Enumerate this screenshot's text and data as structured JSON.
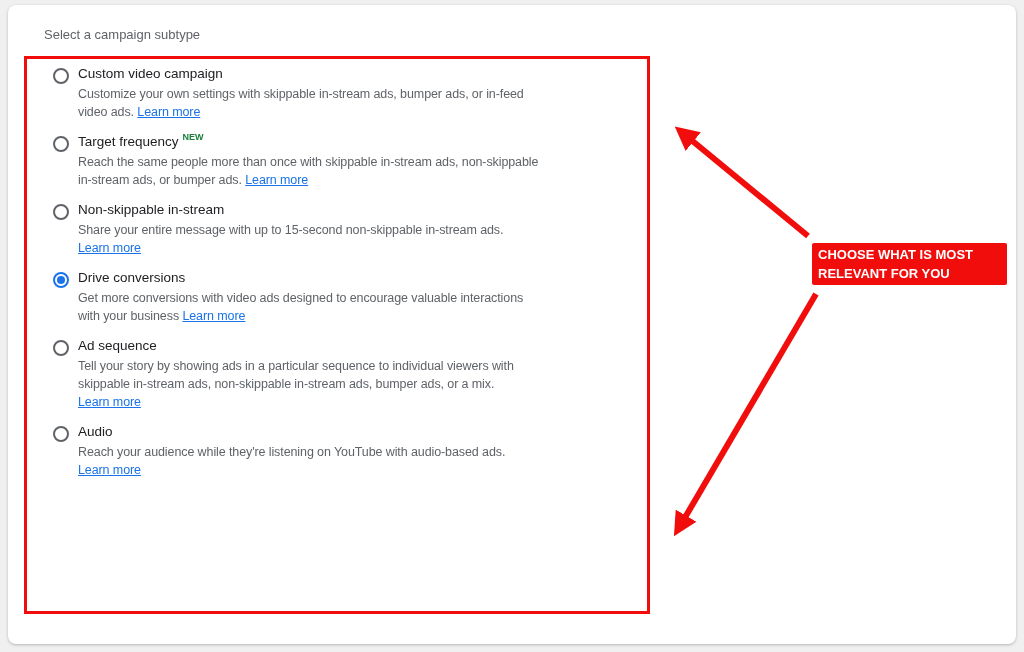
{
  "heading": "Select a campaign subtype",
  "options": [
    {
      "label": "Custom video campaign",
      "description": "Customize your own settings with skippable in-stream ads, bumper ads, or in-feed video ads.",
      "link": "Learn more",
      "selected": false
    },
    {
      "label": "Target frequency",
      "badge": "NEW",
      "description": "Reach the same people more than once with skippable in-stream ads, non-skippable in-stream ads, or bumper ads.",
      "link": "Learn more",
      "selected": false
    },
    {
      "label": "Non-skippable in-stream",
      "description": "Share your entire message with up to 15-second non-skippable in-stream ads.",
      "link": "Learn more",
      "selected": false
    },
    {
      "label": "Drive conversions",
      "description": "Get more conversions with video ads designed to encourage valuable interactions with your business",
      "link": "Learn more",
      "selected": true
    },
    {
      "label": "Ad sequence",
      "description": "Tell your story by showing ads in a particular sequence to individual viewers with skippable in-stream ads, non-skippable in-stream ads, bumper ads, or a mix.",
      "link": "Learn more",
      "selected": false
    },
    {
      "label": "Audio",
      "description": "Reach your audience while they're listening on YouTube with audio-based ads.",
      "link": "Learn more",
      "selected": false
    }
  ],
  "annotation": {
    "text": "CHOOSE WHAT IS MOST RELEVANT FOR YOU"
  }
}
